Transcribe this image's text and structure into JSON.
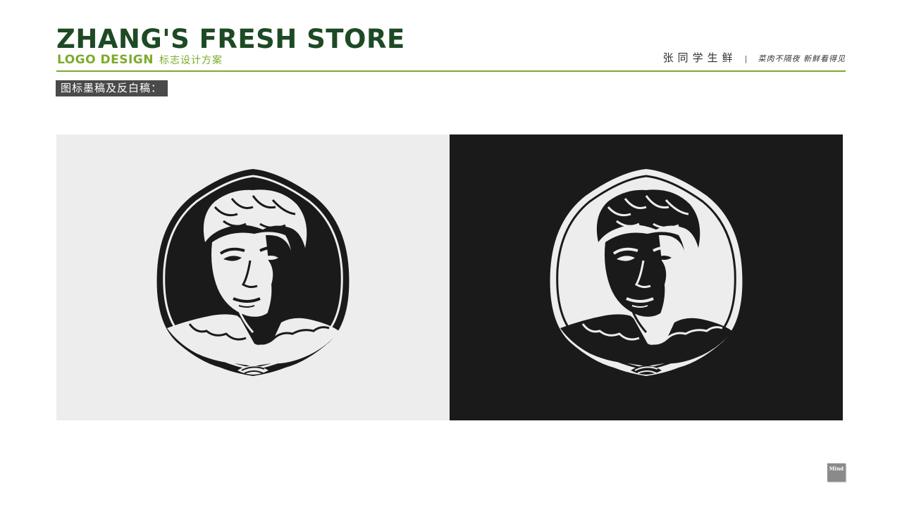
{
  "header": {
    "title": "ZHANG'S FRESH STORE",
    "subtitle_en": "LOGO DESIGN",
    "subtitle_cn": "标志设计方案"
  },
  "brand": {
    "name_cn": "张同学生鲜",
    "separator": "|",
    "slogan": "菜肉不隔夜 新鲜看得见"
  },
  "section": {
    "label": "图标墨稿及反白稿："
  },
  "panels": [
    {
      "name": "ink-draft",
      "background": "#ededed",
      "logo_fill": "#1a1a1a",
      "logo_line": "#ededed"
    },
    {
      "name": "reverse-white-draft",
      "background": "#1a1a1a",
      "logo_fill": "#ededed",
      "logo_line": "#1a1a1a"
    }
  ],
  "badge": {
    "text": "Mind"
  },
  "colors": {
    "title": "#1d4a24",
    "accent": "#7cab2d",
    "label_bg": "#4a4a4a"
  }
}
